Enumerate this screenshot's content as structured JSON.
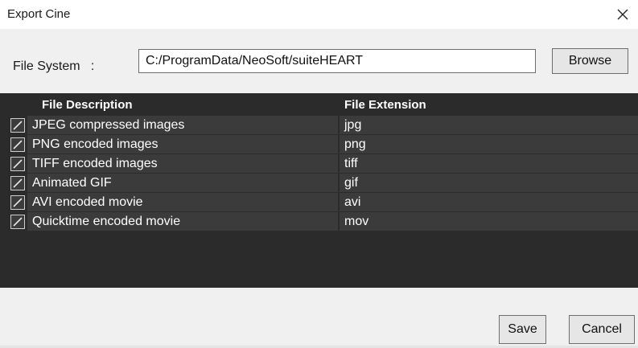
{
  "window": {
    "title": "Export Cine"
  },
  "file_system": {
    "label": "File System   :",
    "path": "C:/ProgramData/NeoSoft/suiteHEART",
    "browse_label": "Browse"
  },
  "table": {
    "headers": {
      "description": "File Description",
      "extension": "File Extension"
    },
    "rows": [
      {
        "checked": true,
        "description": "JPEG compressed images",
        "extension": "jpg"
      },
      {
        "checked": true,
        "description": "PNG encoded images",
        "extension": "png"
      },
      {
        "checked": true,
        "description": "TIFF encoded images",
        "extension": "tiff"
      },
      {
        "checked": true,
        "description": "Animated GIF",
        "extension": "gif"
      },
      {
        "checked": true,
        "description": "AVI encoded movie",
        "extension": "avi"
      },
      {
        "checked": true,
        "description": "Quicktime encoded movie",
        "extension": "mov"
      }
    ]
  },
  "footer": {
    "save_label": "Save",
    "cancel_label": "Cancel"
  },
  "colors": {
    "table_bg": "#2b2b2b",
    "cell_bg": "#3b3b3b",
    "dialog_bg": "#f0f0f0"
  }
}
